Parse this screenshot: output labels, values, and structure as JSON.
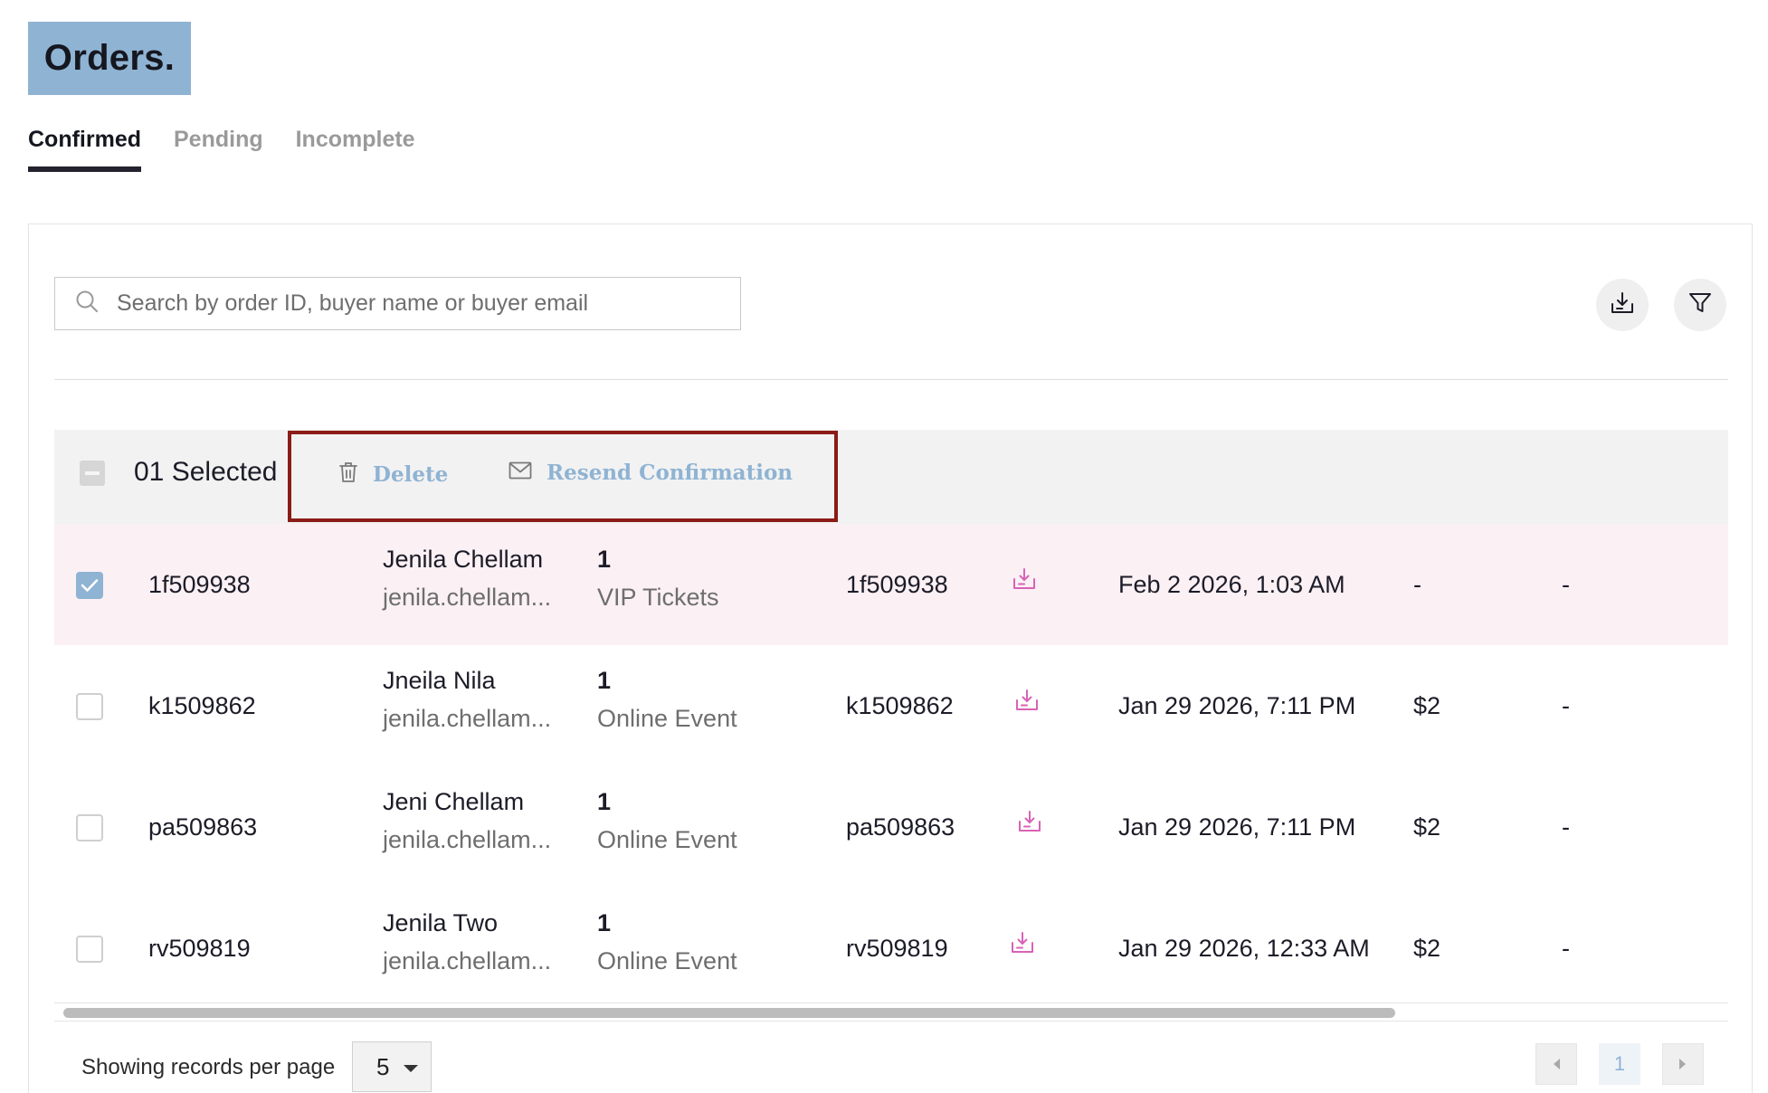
{
  "page": {
    "title": "Orders."
  },
  "tabs": [
    {
      "label": "Confirmed",
      "active": true
    },
    {
      "label": "Pending",
      "active": false
    },
    {
      "label": "Incomplete",
      "active": false
    }
  ],
  "search": {
    "placeholder": "Search by order ID, buyer name or buyer email",
    "value": ""
  },
  "toolbar": {
    "download_icon": "download-icon",
    "filter_icon": "filter-icon"
  },
  "selection": {
    "count_label": "01 Selected",
    "delete_label": "Delete",
    "resend_label": "Resend Confirmation"
  },
  "orders": [
    {
      "id": "1f509938",
      "name": "Jenila Chellam",
      "email": "jenila.chellam...",
      "qty": "1",
      "ticket": "VIP Tickets",
      "ref": "1f509938",
      "date": "Feb 2 2026, 1:03 AM",
      "amount": "-",
      "extra": "-",
      "checked": true
    },
    {
      "id": "k1509862",
      "name": "Jneila Nila",
      "email": "jenila.chellam...",
      "qty": "1",
      "ticket": "Online Event",
      "ref": "k1509862",
      "date": "Jan 29 2026, 7:11 PM",
      "amount": "$2",
      "extra": "-",
      "checked": false
    },
    {
      "id": "pa509863",
      "name": "Jeni Chellam",
      "email": "jenila.chellam...",
      "qty": "1",
      "ticket": "Online Event",
      "ref": "pa509863",
      "date": "Jan 29 2026, 7:11 PM",
      "amount": "$2",
      "extra": "-",
      "checked": false
    },
    {
      "id": "rv509819",
      "name": "Jenila Two",
      "email": "jenila.chellam...",
      "qty": "1",
      "ticket": "Online Event",
      "ref": "rv509819",
      "date": "Jan 29 2026, 12:33 AM",
      "amount": "$2",
      "extra": "-",
      "checked": false
    }
  ],
  "pagination": {
    "per_page_label": "Showing records per page",
    "per_page_value": "5",
    "current_page": "1"
  },
  "colors": {
    "accent": "#8fb3d3",
    "highlight_row": "#fbf0f4",
    "download_pink": "#d863b6",
    "action_box": "#8b1c16"
  }
}
